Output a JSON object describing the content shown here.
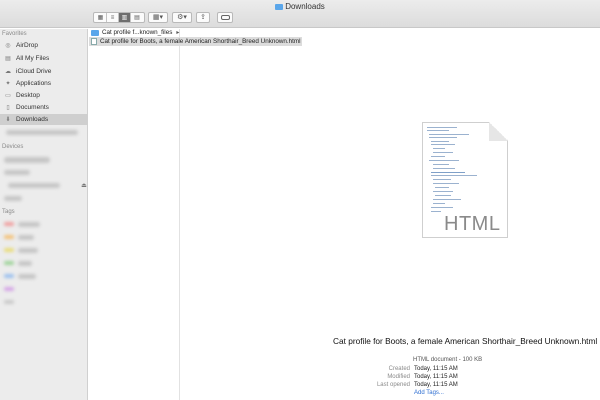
{
  "window": {
    "title": "Downloads"
  },
  "toolbar": {
    "view_buttons": [
      "icon-view",
      "list-view",
      "column-view",
      "cover-flow-view"
    ],
    "active_view": "column-view",
    "arrange_icon": "grid-icon",
    "action_icon": "gear-icon",
    "share_icon": "share-icon",
    "tags_icon": "tag-icon"
  },
  "sidebar": {
    "favorites_title": "Favorites",
    "favorites": [
      {
        "label": "AirDrop",
        "icon": "airdrop-icon"
      },
      {
        "label": "All My Files",
        "icon": "all-files-icon"
      },
      {
        "label": "iCloud Drive",
        "icon": "cloud-icon"
      },
      {
        "label": "Applications",
        "icon": "applications-icon"
      },
      {
        "label": "Desktop",
        "icon": "desktop-icon"
      },
      {
        "label": "Documents",
        "icon": "documents-icon"
      },
      {
        "label": "Downloads",
        "icon": "downloads-icon",
        "selected": true
      }
    ],
    "devices_title": "Devices",
    "tags_title": "Tags",
    "tag_colors": [
      "#f0a0a0",
      "#f3c27a",
      "#e9dc7a",
      "#9fd39a",
      "#9cc0ee",
      "#d5a6e6",
      "#c9c9c9"
    ]
  },
  "column1": {
    "items": [
      {
        "label": "Cat profile f...known_files",
        "kind": "folder",
        "has_children": true
      },
      {
        "label": "Cat profile for Boots, a female American Shorthair_Breed Unknown.html",
        "kind": "html",
        "selected": true
      }
    ]
  },
  "preview": {
    "icon_label": "HTML",
    "file_name": "Cat profile for Boots, a female American Shorthair_Breed Unknown.html",
    "kind_size": "HTML document - 100 KB",
    "created_label": "Created",
    "created_value": "Today, 11:15 AM",
    "modified_label": "Modified",
    "modified_value": "Today, 11:15 AM",
    "last_opened_label": "Last opened",
    "last_opened_value": "Today, 11:15 AM",
    "add_tags": "Add Tags..."
  },
  "colors": {
    "accent": "#2f6fd2",
    "folder": "#5aa6ea",
    "sidebar": "#ececec"
  }
}
